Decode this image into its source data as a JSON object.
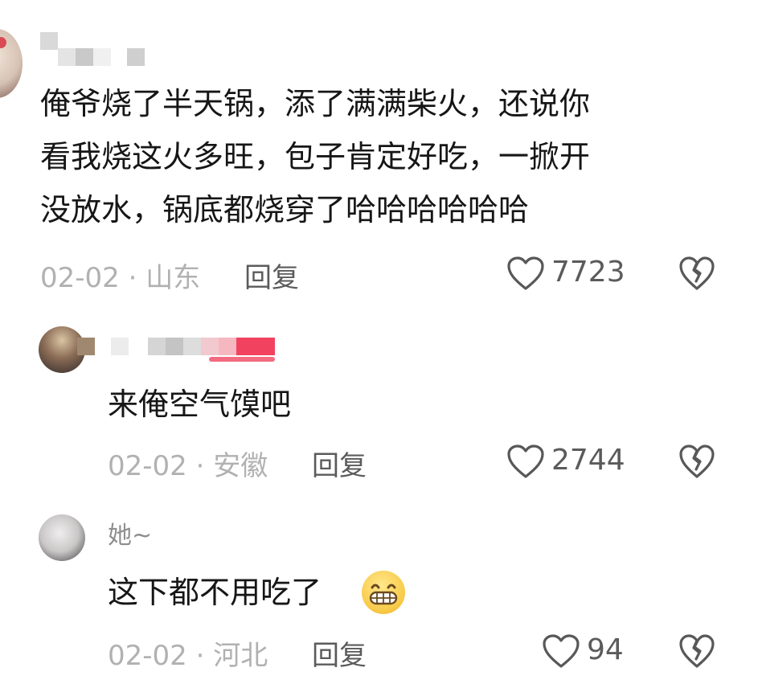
{
  "comments": [
    {
      "text": "俺爷烧了半天锅，添了满满柴火，还说你\n看我烧这火多旺，包子肯定好吃，一掀开\n没放水，锅底都烧穿了哈哈哈哈哈哈",
      "date": "02-02",
      "location": "山东",
      "reply_label": "回复",
      "likes": "7723"
    },
    {
      "text": "来俺空气馍吧",
      "date": "02-02",
      "location": "安徽",
      "reply_label": "回复",
      "likes": "2744"
    },
    {
      "username": "她~",
      "text": "这下都不用吃了",
      "date": "02-02",
      "location": "河北",
      "reply_label": "回复",
      "likes": "94"
    }
  ],
  "separator": " · ",
  "icons": [
    "heart-outline-icon",
    "broken-heart-icon",
    "grin-emoji-icon"
  ]
}
